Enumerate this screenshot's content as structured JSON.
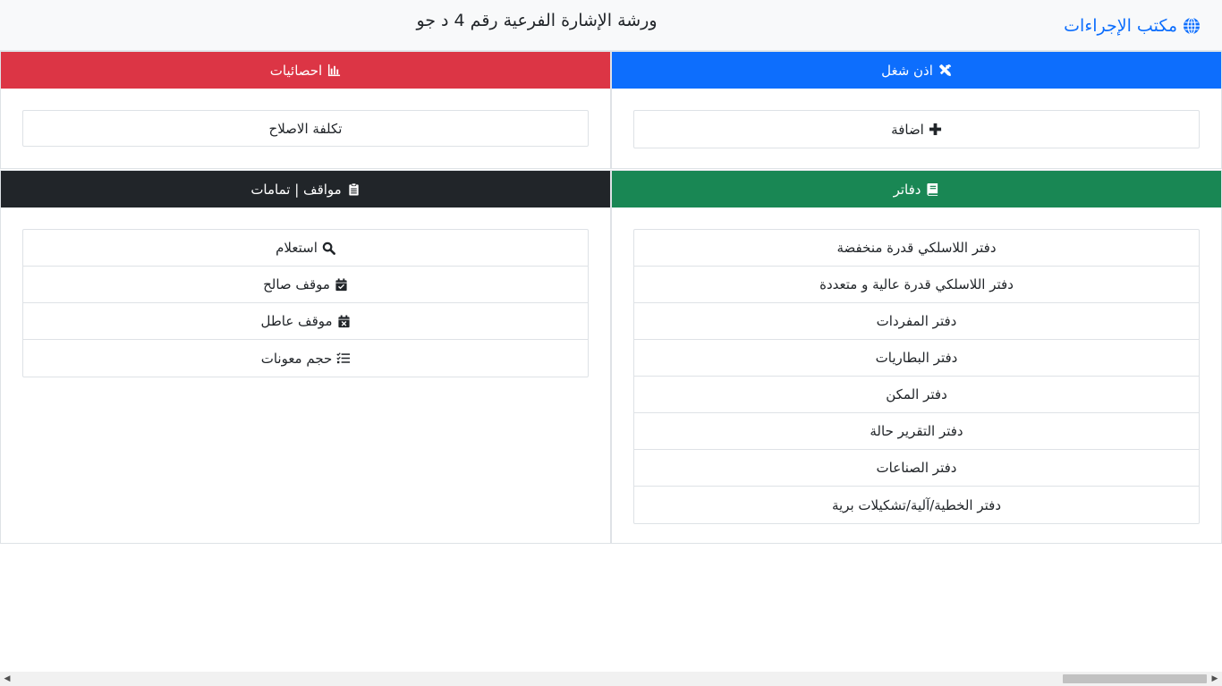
{
  "navbar": {
    "brand_label": "مكتب الإجراءات",
    "brand_icon": "globe-icon",
    "title": "ورشة الإشارة الفرعية رقم 4 د جو"
  },
  "colors": {
    "blue": "#0d6efd",
    "red": "#dc3545",
    "green": "#198754",
    "dark": "#212529",
    "navbar_bg": "#f8f9fa"
  },
  "panels": {
    "work_permit": {
      "title": "اذن شغل",
      "icon": "tools-icon",
      "items": [
        {
          "label": "اضافة",
          "icon": "plus-icon"
        }
      ]
    },
    "statistics": {
      "title": "احصائيات",
      "icon": "chart-icon",
      "items": [
        {
          "label": "تكلفة الاصلاح"
        }
      ]
    },
    "ledgers": {
      "title": "دفاتر",
      "icon": "book-icon",
      "items": [
        {
          "label": "دفتر اللاسلكي قدرة منخفضة"
        },
        {
          "label": "دفتر اللاسلكي قدرة عالية و متعددة"
        },
        {
          "label": "دفتر المفردات"
        },
        {
          "label": "دفتر البطاريات"
        },
        {
          "label": "دفتر المكن"
        },
        {
          "label": "دفتر التقرير حالة"
        },
        {
          "label": "دفتر الصناعات"
        },
        {
          "label": "دفتر الخطية/آلية/تشكيلات برية"
        }
      ]
    },
    "statuses": {
      "title": "مواقف | تمامات",
      "icon": "clipboard-icon",
      "items": [
        {
          "label": "استعلام",
          "icon": "search-icon"
        },
        {
          "label": "موقف صالح",
          "icon": "calendar-check-icon"
        },
        {
          "label": "موقف عاطل",
          "icon": "calendar-x-icon"
        },
        {
          "label": "حجم معونات",
          "icon": "list-check-icon"
        }
      ]
    }
  }
}
